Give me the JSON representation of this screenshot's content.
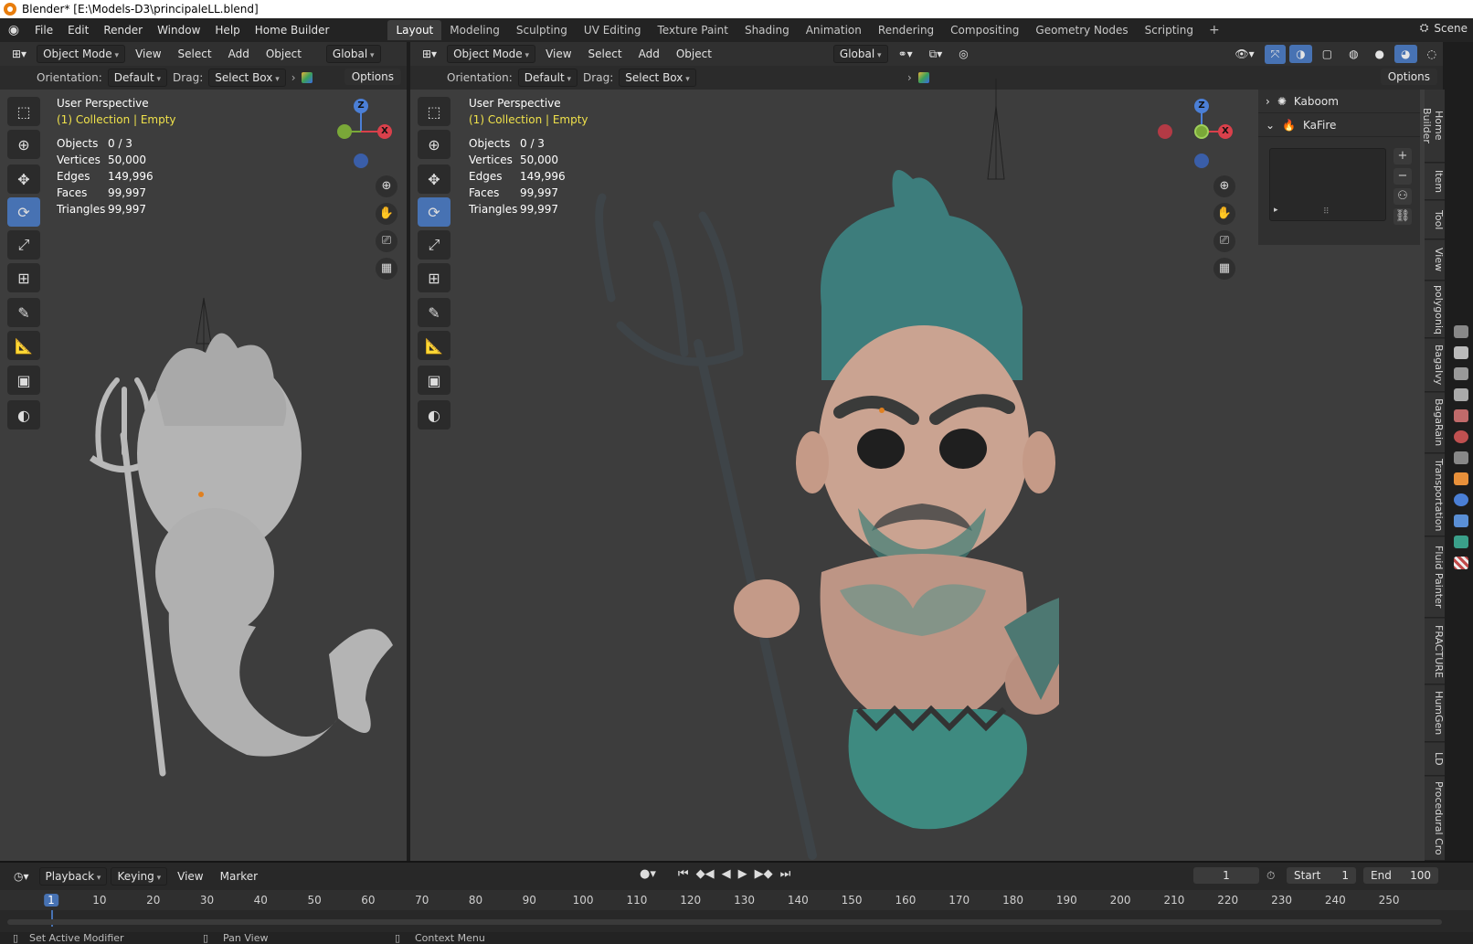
{
  "window": {
    "title": "Blender* [E:\\Models-D3\\principaleLL.blend]"
  },
  "menu": [
    "File",
    "Edit",
    "Render",
    "Window",
    "Help",
    "Home Builder"
  ],
  "workspaces": [
    "Layout",
    "Modeling",
    "Sculpting",
    "UV Editing",
    "Texture Paint",
    "Shading",
    "Animation",
    "Rendering",
    "Compositing",
    "Geometry Nodes",
    "Scripting"
  ],
  "active_workspace": "Layout",
  "scene": {
    "label": "Scene"
  },
  "viewport_header": {
    "mode": "Object Mode",
    "menus": [
      "View",
      "Select",
      "Add",
      "Object"
    ],
    "transform_orientation": "Global",
    "orientation_label": "Orientation:",
    "orientation_value": "Default",
    "drag_label": "Drag:",
    "drag_value": "Select Box",
    "options": "Options"
  },
  "overlay": {
    "perspective": "User Perspective",
    "collection": "(1) Collection | Empty",
    "stats": [
      {
        "label": "Objects",
        "value": "0 / 3"
      },
      {
        "label": "Vertices",
        "value": "50,000"
      },
      {
        "label": "Edges",
        "value": "149,996"
      },
      {
        "label": "Faces",
        "value": "99,997"
      },
      {
        "label": "Triangles",
        "value": "99,997"
      }
    ]
  },
  "gizmo": {
    "x": "X",
    "z": "Z"
  },
  "addon_panel": {
    "items": [
      "Kaboom",
      "KaFire"
    ]
  },
  "n_tabs": [
    "Home Builder",
    "Item",
    "Tool",
    "View",
    "polygoniq",
    "BagaIvy",
    "BagaRain",
    "Transportation",
    "Fluid Painter",
    "FRACTURE",
    "HumGen",
    "LD",
    "Procedural Cro"
  ],
  "timeline": {
    "menus": [
      "Playback",
      "Keying",
      "View",
      "Marker"
    ],
    "current_frame": "1",
    "start_label": "Start",
    "start": "1",
    "end_label": "End",
    "end": "100",
    "ticks": [
      "1",
      "10",
      "20",
      "30",
      "40",
      "50",
      "60",
      "70",
      "80",
      "90",
      "100",
      "110",
      "120",
      "130",
      "140",
      "150",
      "160",
      "170",
      "180",
      "190",
      "200",
      "210",
      "220",
      "230",
      "240",
      "250"
    ]
  },
  "status_bar": {
    "left": "Set Active Modifier",
    "middle": "Pan View",
    "right": "Context Menu"
  }
}
